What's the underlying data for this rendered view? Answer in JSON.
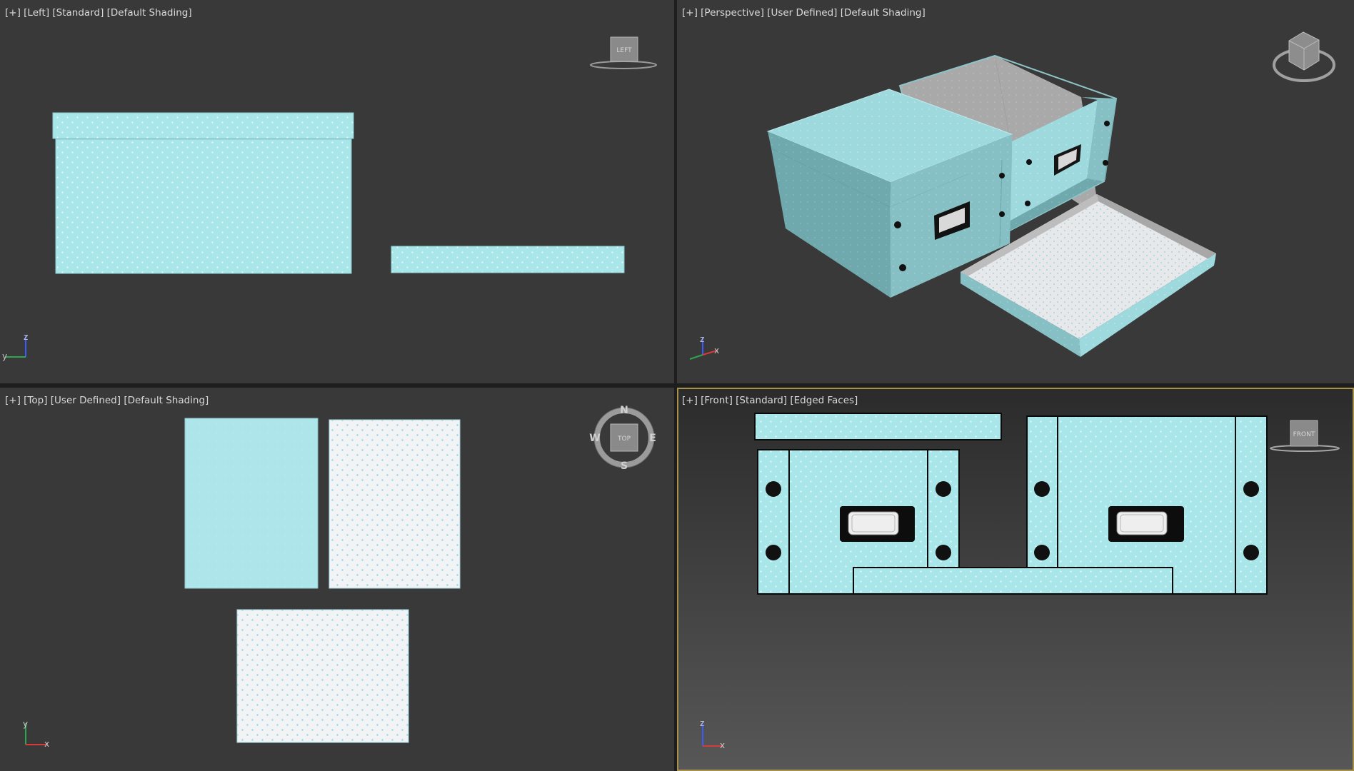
{
  "viewports": {
    "left": {
      "plus": "[+]",
      "view": "[Left]",
      "camera": "[Standard]",
      "shading": "[Default Shading]",
      "cube_label": "LEFT"
    },
    "perspective": {
      "plus": "[+]",
      "view": "[Perspective]",
      "camera": "[User Defined]",
      "shading": "[Default Shading]"
    },
    "top": {
      "plus": "[+]",
      "view": "[Top]",
      "camera": "[User Defined]",
      "shading": "[Default Shading]",
      "cube_label": "TOP",
      "compass": {
        "n": "N",
        "s": "S",
        "e": "E",
        "w": "W"
      }
    },
    "front": {
      "plus": "[+]",
      "view": "[Front]",
      "camera": "[Standard]",
      "shading": "[Edged Faces]",
      "cube_label": "FRONT",
      "active": true
    }
  },
  "axes": {
    "left": {
      "a": "z",
      "b": "y"
    },
    "perspective": {
      "a": "z",
      "b": "x"
    },
    "top": {
      "a": "y",
      "b": "x"
    },
    "front": {
      "a": "z",
      "b": "x"
    }
  },
  "colors": {
    "viewport_bg": "#393939",
    "box_cyan": "#a9e6ea",
    "box_white": "#f1f3f4",
    "dot_light": "#e9fbfc",
    "dot_blue": "#8fd4e4",
    "active_border": "#a8914a"
  }
}
